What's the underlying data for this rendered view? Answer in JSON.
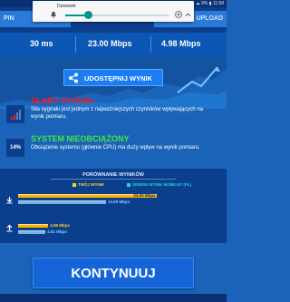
{
  "status_bar": {
    "right_text": "☁ 9% ▮ 11:58"
  },
  "notification": {
    "title": "Dzwonek",
    "volume_fraction": 0.22
  },
  "header": {
    "tabs": [
      {
        "label": "PIN"
      },
      {
        "label": "UPLOAD"
      }
    ]
  },
  "results": {
    "ping": "30 ms",
    "download": "23.00 Mbps",
    "upload": "4.98 Mbps"
  },
  "share": {
    "label": "UDOSTĘPNIJ WYNIK"
  },
  "signal": {
    "title": "SŁABY SYGNAŁ",
    "description": "Siła sygnału jest jednym z najważniejszych czynników wpływających na wynik pomiaru."
  },
  "system": {
    "badge": "14%",
    "title": "SYSTEM NIEOBCIĄŻONY",
    "description": "Obciążenie systemu (głównie CPU) ma duży wpływ na wynik pomiaru."
  },
  "comparison": {
    "title": "PORÓWNANIE WYNIKÓW",
    "legend": {
      "yours": "TWÓJ WYNIK",
      "average": "ŚREDNI WYNIK MOBILNY (PL)"
    },
    "download": {
      "yours_value": 23.0,
      "yours_label": "23.00 Mbps",
      "avg_value": 14.55,
      "avg_label": "14.55 Mbps"
    },
    "upload": {
      "yours_value": 4.98,
      "yours_label": "4.98 Mbps",
      "avg_value": 4.51,
      "avg_label": "4.51 Mbps"
    },
    "scale_max": 30
  },
  "continue": {
    "label": "KONTYNUUJ"
  },
  "colors": {
    "background": "#1a63b8",
    "header": "#0b3f8e",
    "accent_red": "#ff1a1a",
    "accent_green": "#3fe83f",
    "bar_yours": "#ffb300",
    "bar_avg": "#7ab3e0",
    "button": "#1565d8"
  }
}
